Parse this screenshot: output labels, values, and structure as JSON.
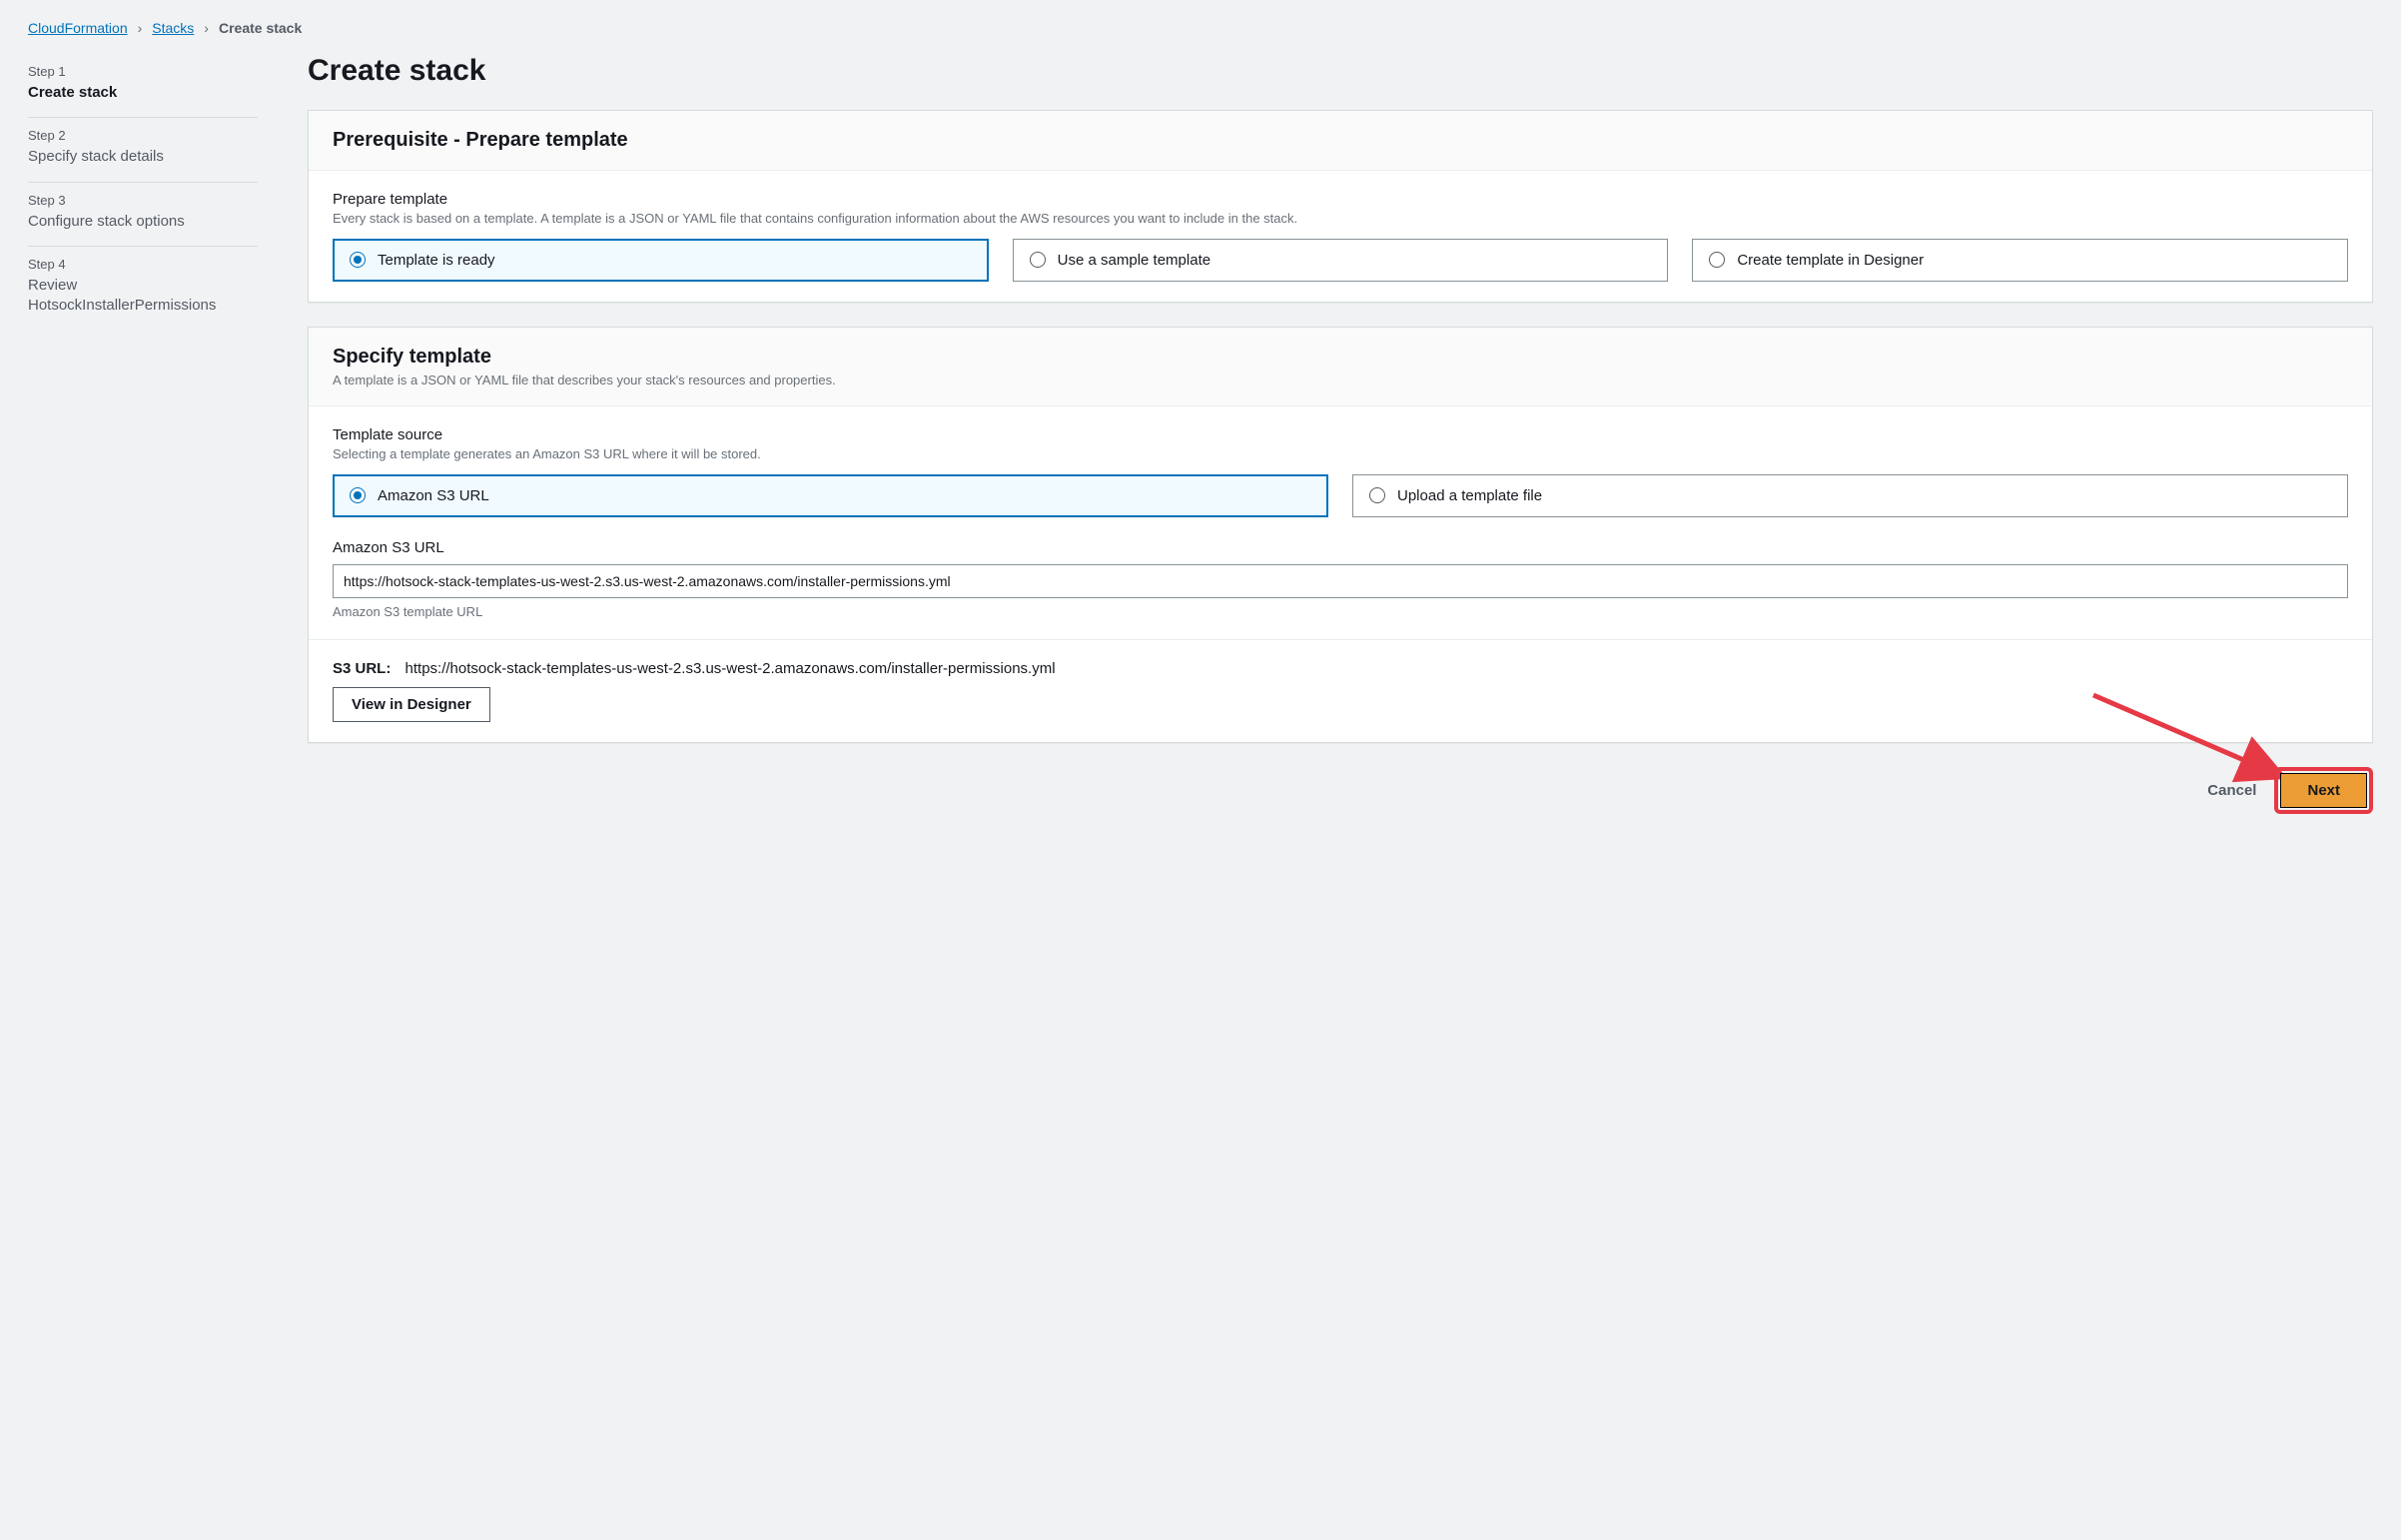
{
  "breadcrumb": {
    "items": [
      "CloudFormation",
      "Stacks"
    ],
    "current": "Create stack"
  },
  "steps": [
    {
      "label": "Step 1",
      "name": "Create stack",
      "active": true
    },
    {
      "label": "Step 2",
      "name": "Specify stack details",
      "active": false
    },
    {
      "label": "Step 3",
      "name": "Configure stack options",
      "active": false
    },
    {
      "label": "Step 4",
      "name": "Review HotsockInstallerPermissions",
      "active": false
    }
  ],
  "page_title": "Create stack",
  "prereq": {
    "header": "Prerequisite - Prepare template",
    "prepare_label": "Prepare template",
    "prepare_hint": "Every stack is based on a template. A template is a JSON or YAML file that contains configuration information about the AWS resources you want to include in the stack.",
    "options": [
      "Template is ready",
      "Use a sample template",
      "Create template in Designer"
    ],
    "selected_index": 0
  },
  "specify": {
    "header": "Specify template",
    "subtitle": "A template is a JSON or YAML file that describes your stack's resources and properties.",
    "source_label": "Template source",
    "source_hint": "Selecting a template generates an Amazon S3 URL where it will be stored.",
    "source_options": [
      "Amazon S3 URL",
      "Upload a template file"
    ],
    "source_selected_index": 0,
    "url_label": "Amazon S3 URL",
    "url_value": "https://hotsock-stack-templates-us-west-2.s3.us-west-2.amazonaws.com/installer-permissions.yml",
    "url_sublabel": "Amazon S3 template URL",
    "s3url_label": "S3 URL:",
    "s3url_value": "https://hotsock-stack-templates-us-west-2.s3.us-west-2.amazonaws.com/installer-permissions.yml",
    "view_designer": "View in Designer"
  },
  "footer": {
    "cancel": "Cancel",
    "next": "Next"
  }
}
